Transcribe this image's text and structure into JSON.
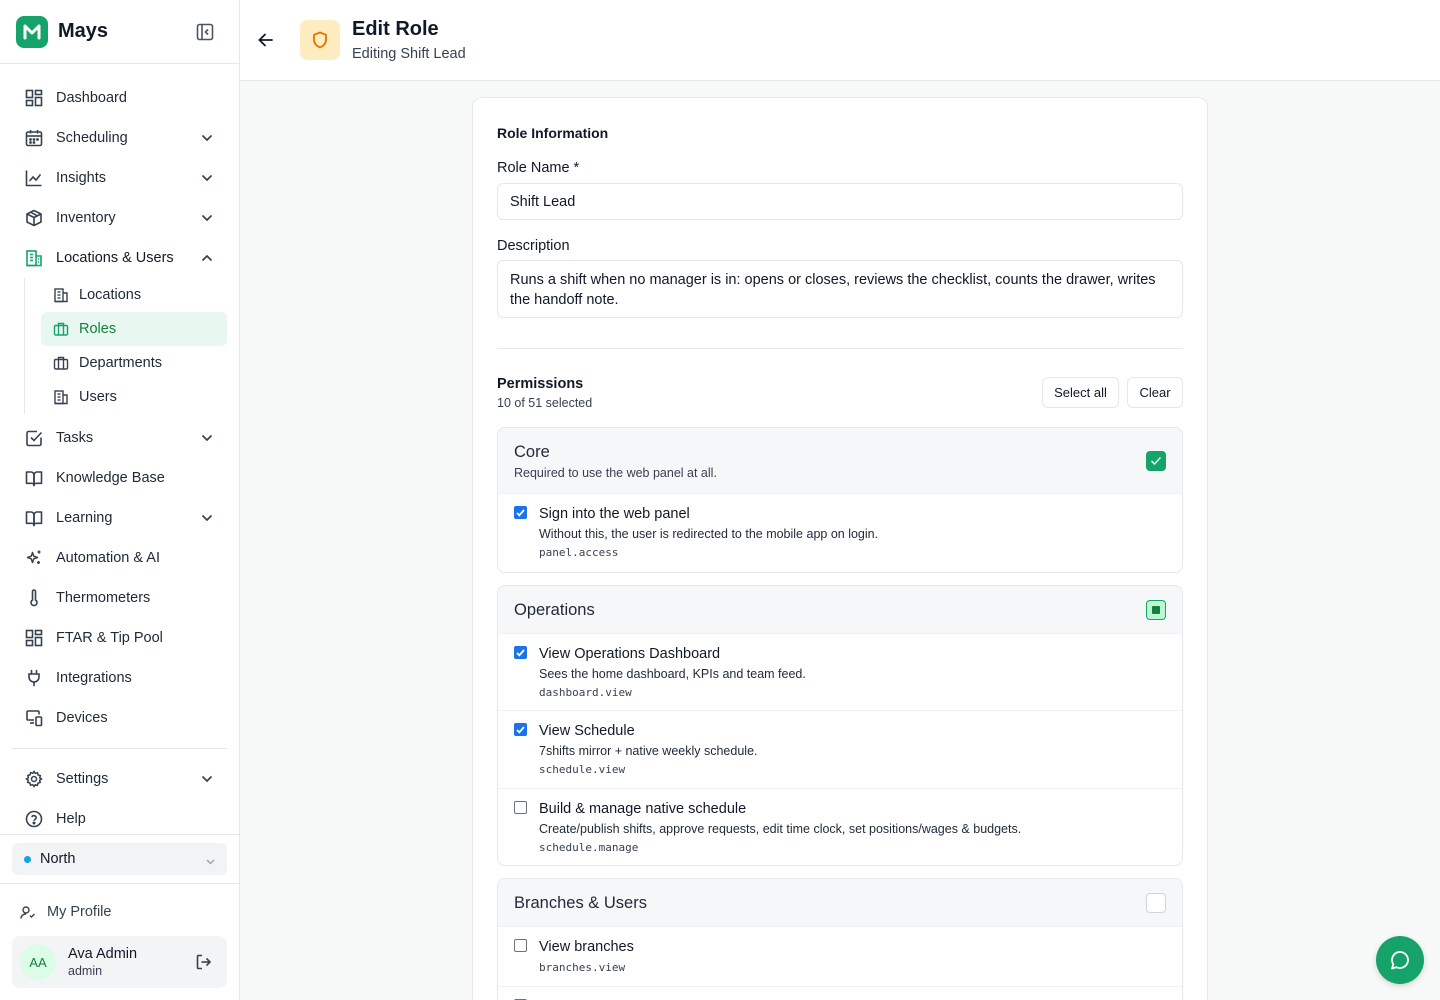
{
  "app": {
    "name": "Mays"
  },
  "sidebar": {
    "items": [
      {
        "label": "Dashboard",
        "icon": "dashboard-icon"
      },
      {
        "label": "Scheduling",
        "icon": "calendar-icon"
      },
      {
        "label": "Insights",
        "icon": "chart-line-icon"
      },
      {
        "label": "Inventory",
        "icon": "box-icon"
      },
      {
        "label": "Locations & Users",
        "icon": "building-icon"
      },
      {
        "label": "Tasks",
        "icon": "checkbox-icon"
      },
      {
        "label": "Knowledge Base",
        "icon": "book-open-icon"
      },
      {
        "label": "Learning",
        "icon": "book-icon"
      },
      {
        "label": "Automation & AI",
        "icon": "sparkles-icon"
      },
      {
        "label": "Thermometers",
        "icon": "thermometer-icon"
      },
      {
        "label": "FTAR & Tip Pool",
        "icon": "grid-icon"
      },
      {
        "label": "Integrations",
        "icon": "plug-icon"
      },
      {
        "label": "Devices",
        "icon": "devices-icon"
      }
    ],
    "sub_items": [
      {
        "label": "Locations"
      },
      {
        "label": "Roles",
        "active": true
      },
      {
        "label": "Departments"
      },
      {
        "label": "Users"
      }
    ],
    "bottom_items": [
      {
        "label": "Settings",
        "icon": "gear-icon"
      },
      {
        "label": "Help",
        "icon": "help-icon"
      }
    ],
    "location": "North",
    "profile_link": "My Profile",
    "user": {
      "initials": "AA",
      "name": "Ava Admin",
      "role": "admin"
    }
  },
  "header": {
    "title": "Edit Role",
    "subtitle": "Editing Shift Lead"
  },
  "form": {
    "section_title": "Role Information",
    "role_name_label": "Role Name *",
    "role_name_value": "Shift Lead",
    "description_label": "Description",
    "description_value": "Runs a shift when no manager is in: opens or closes, reviews the checklist, counts the drawer, writes the handoff note."
  },
  "permissions": {
    "title": "Permissions",
    "count": "10 of 51 selected",
    "select_all": "Select all",
    "clear": "Clear",
    "groups": [
      {
        "name": "Core",
        "description": "Required to use the web panel at all.",
        "state": "checked",
        "items": [
          {
            "name": "Sign into the web panel",
            "description": "Without this, the user is redirected to the mobile app on login.",
            "key": "panel.access",
            "checked": true
          }
        ]
      },
      {
        "name": "Operations",
        "state": "partial",
        "items": [
          {
            "name": "View Operations Dashboard",
            "description": "Sees the home dashboard, KPIs and team feed.",
            "key": "dashboard.view",
            "checked": true
          },
          {
            "name": "View Schedule",
            "description": "7shifts mirror + native weekly schedule.",
            "key": "schedule.view",
            "checked": true
          },
          {
            "name": "Build & manage native schedule",
            "description": "Create/publish shifts, approve requests, edit time clock, set positions/wages & budgets.",
            "key": "schedule.manage",
            "checked": false
          }
        ]
      },
      {
        "name": "Branches & Users",
        "state": "unchecked",
        "items": [
          {
            "name": "View branches",
            "description": "",
            "key": "branches.view",
            "checked": false
          }
        ]
      }
    ]
  },
  "colors": {
    "accent": "#16a36a",
    "active_bg": "#e8f7ef",
    "checkbox_blue": "#1a73e8",
    "role_icon_bg": "#fdecc0"
  }
}
